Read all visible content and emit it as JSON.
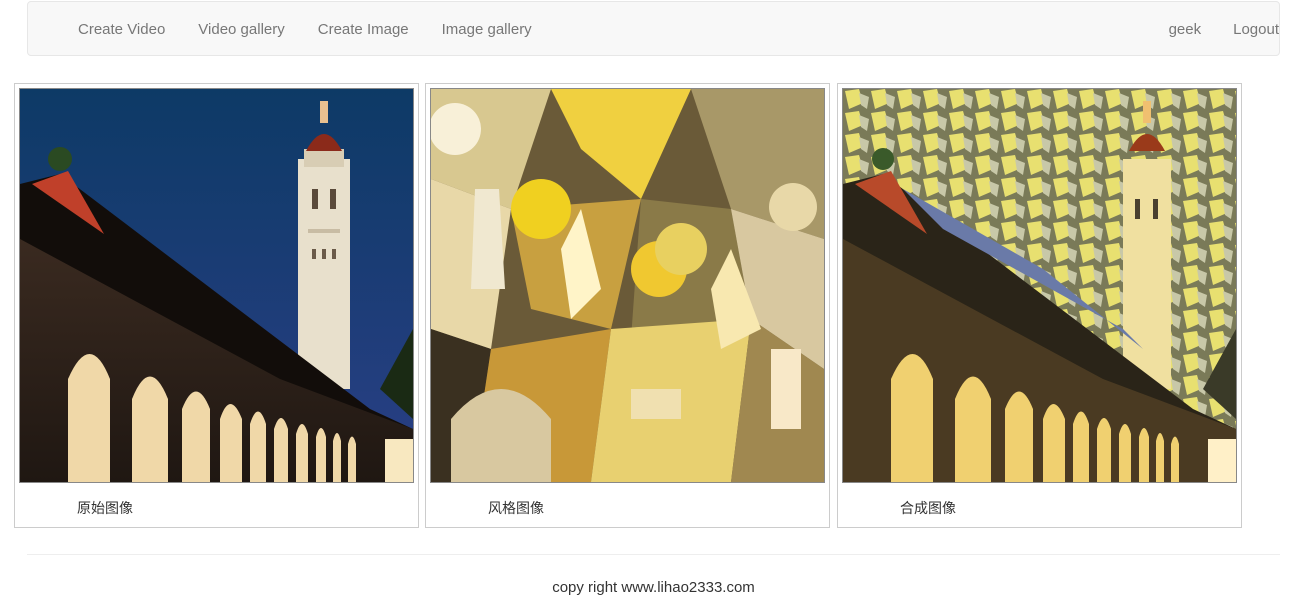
{
  "navbar": {
    "left_links": [
      {
        "label": "Create Video"
      },
      {
        "label": "Video gallery"
      },
      {
        "label": "Create Image"
      },
      {
        "label": "Image gallery"
      }
    ],
    "right_links": [
      {
        "label": "geek"
      },
      {
        "label": "Logout"
      }
    ]
  },
  "gallery": {
    "items": [
      {
        "caption": "原始图像"
      },
      {
        "caption": "风格图像"
      },
      {
        "caption": "合成图像"
      }
    ]
  },
  "footer": {
    "text": "copy right www.lihao2333.com"
  }
}
